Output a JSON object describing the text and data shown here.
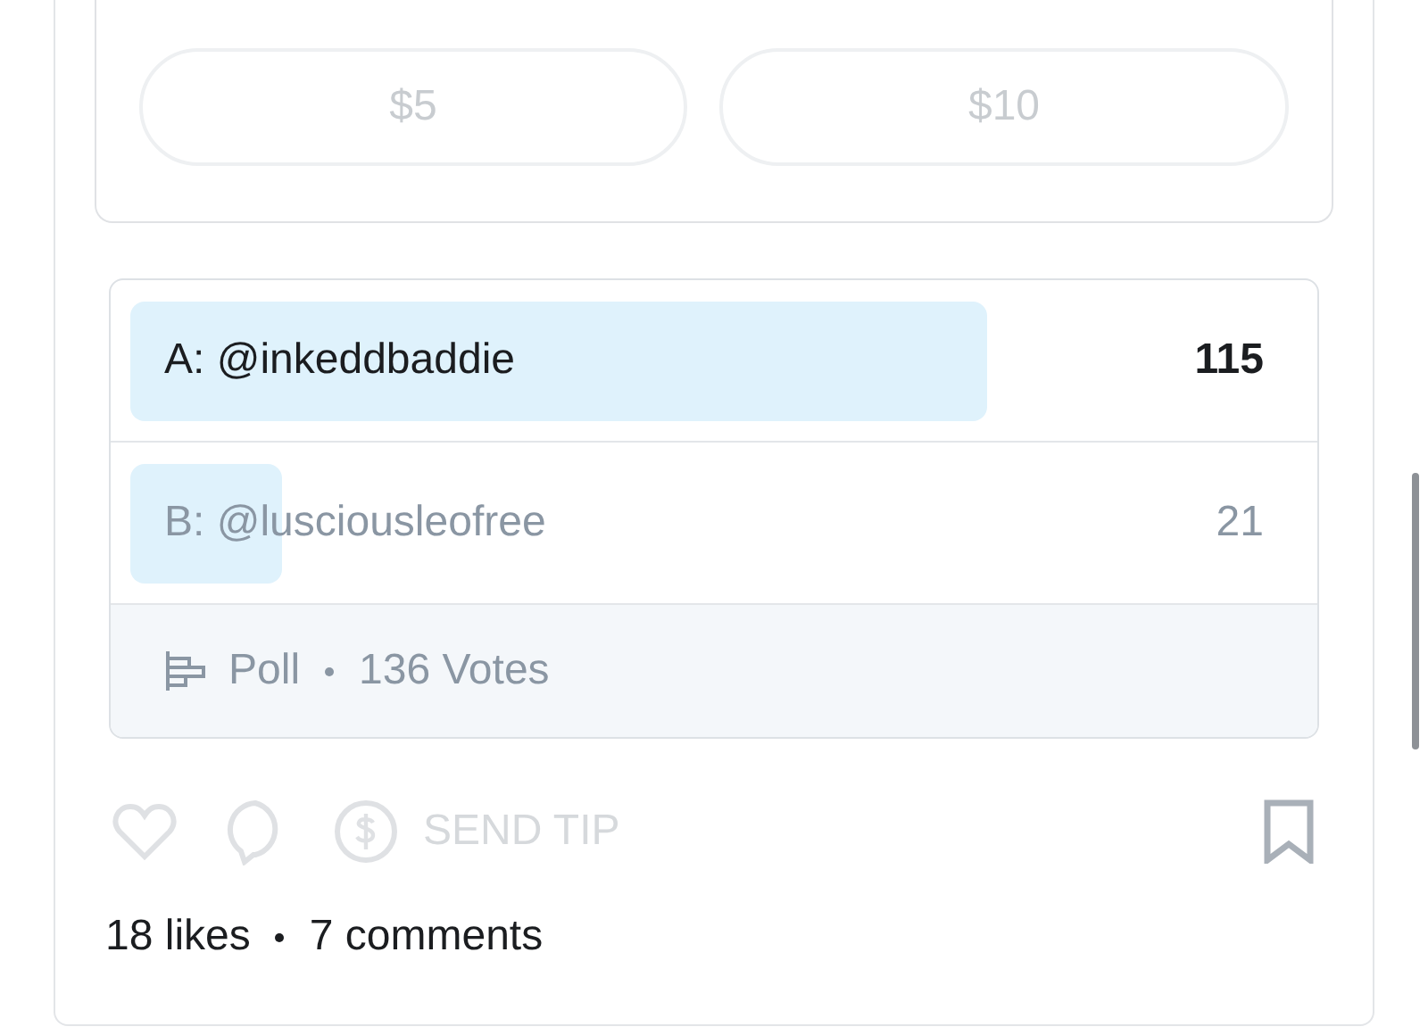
{
  "tip_amounts": [
    "$5",
    "$10"
  ],
  "poll": {
    "options": [
      {
        "label": "A: @inkeddbaddie",
        "count": "115",
        "level": 0.85,
        "selected": true
      },
      {
        "label": "B: @lusciousleofree",
        "count": "21",
        "level": 0.15,
        "selected": false
      }
    ],
    "kind_label": "Poll",
    "votes": "136 Votes"
  },
  "actions": {
    "send_tip": "SEND TIP"
  },
  "stats": {
    "likes": "18 likes",
    "comments": "7 comments"
  }
}
